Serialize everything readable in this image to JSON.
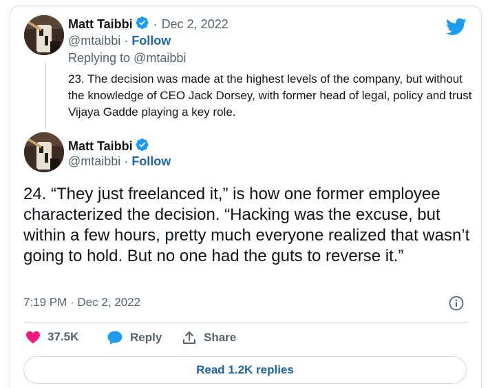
{
  "first_tweet": {
    "author_name": "Matt Taibbi",
    "date": "Dec 2, 2022",
    "handle": "@mtaibbi",
    "follow_label": "Follow",
    "replying_to": "Replying to @mtaibbi",
    "text": "23. The decision was made at the highest levels of the company, but without the knowledge of CEO Jack Dorsey, with former head of legal, policy and trust Vijaya Gadde playing a key role."
  },
  "main_tweet": {
    "author_name": "Matt Taibbi",
    "handle": "@mtaibbi",
    "follow_label": "Follow",
    "text": "24. “They just freelanced it,” is how one former employee characterized the decision. “Hacking was the excuse, but within a few hours, pretty much everyone realized that wasn’t going to hold. But no one had the guts to reverse it.”",
    "timestamp": "7:19 PM · Dec 2, 2022"
  },
  "actions": {
    "likes_count": "37.5K",
    "reply_label": "Reply",
    "share_label": "Share",
    "read_replies_label": "Read 1.2K replies"
  },
  "colors": {
    "like_pink": "#f91880",
    "twitter_blue": "#1d9bf0",
    "link_blue": "#1d65a6"
  },
  "icons": [
    "twitter-bird-icon",
    "verified-badge-icon",
    "info-icon",
    "heart-icon",
    "reply-bubble-icon",
    "share-icon"
  ]
}
